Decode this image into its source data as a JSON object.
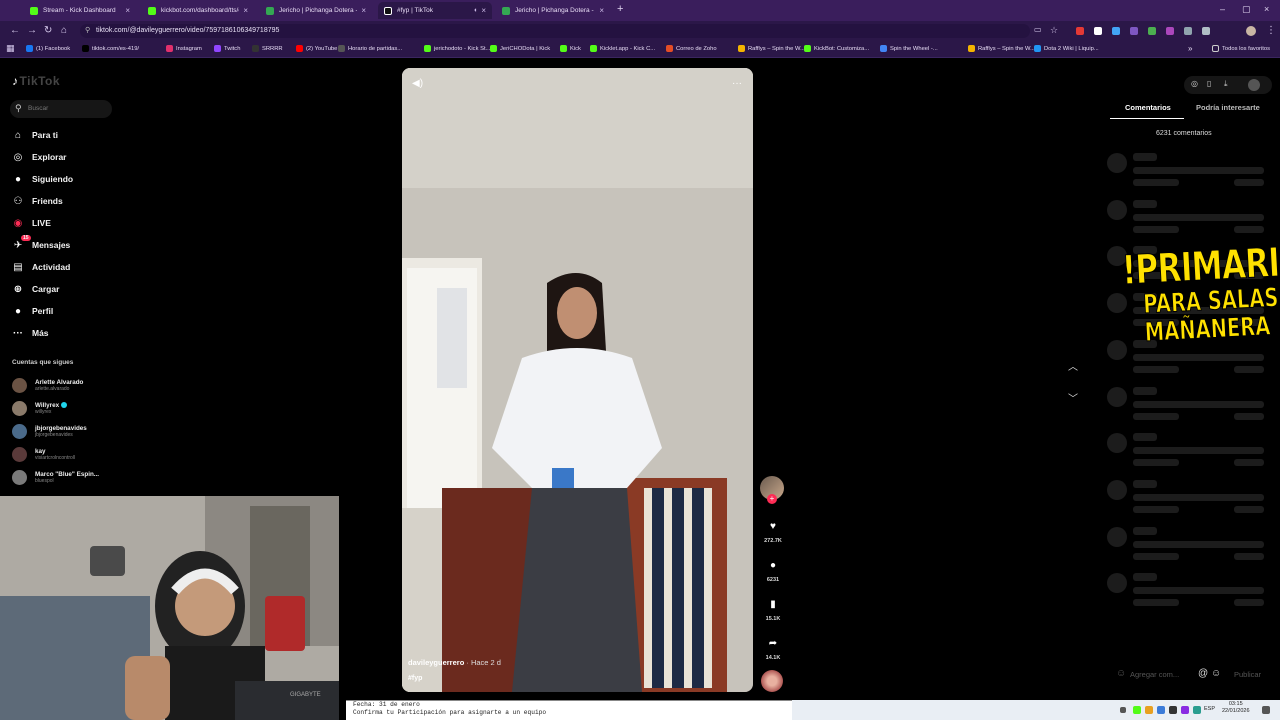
{
  "browser": {
    "tabs": [
      {
        "label": "Stream - Kick Dashboard",
        "color": "#53fc18",
        "active": false
      },
      {
        "label": "kickbot.com/dashboard/tts/co",
        "color": "#53fc18",
        "active": false
      },
      {
        "label": "Jericho | Pichanga Dotera - Ho",
        "color": "#34a853",
        "active": false
      },
      {
        "label": "#fyp | TikTok",
        "color": "#ffffff",
        "active": true
      },
      {
        "label": "Jericho | Pichanga Dotera - Ho",
        "color": "#34a853",
        "active": false
      }
    ],
    "url": "tiktok.com/@davileyguerrero/video/7597186106349718795",
    "bookmarks": [
      {
        "label": "(1) Facebook",
        "color": "#1877f2"
      },
      {
        "label": "tiktok.com/es-419/",
        "color": "#000000"
      },
      {
        "label": "Instagram",
        "color": "#e1306c"
      },
      {
        "label": "Twitch",
        "color": "#9146ff"
      },
      {
        "label": "SRRRR",
        "color": "#333333"
      },
      {
        "label": "(2) YouTube",
        "color": "#ff0000"
      },
      {
        "label": "Horario de partidas...",
        "color": "#555555"
      },
      {
        "label": "jerichodoto - Kick St...",
        "color": "#53fc18"
      },
      {
        "label": "JeriCHODota | Kick",
        "color": "#53fc18"
      },
      {
        "label": "Kick",
        "color": "#53fc18"
      },
      {
        "label": "Kicklet.app - Kick C...",
        "color": "#53fc18"
      },
      {
        "label": "Correo de Zoho",
        "color": "#e44d26"
      },
      {
        "label": "Rafflys – Spin the W...",
        "color": "#f4b400"
      },
      {
        "label": "KickBot: Customiza...",
        "color": "#53fc18"
      },
      {
        "label": "Spin the Wheel -...",
        "color": "#4285f4"
      },
      {
        "label": "Rafflys – Spin the W...",
        "color": "#f4b400"
      },
      {
        "label": "Dota 2 Wiki | Liquip...",
        "color": "#2196f3"
      }
    ],
    "bookmarks_all": "Todos los favoritos"
  },
  "sidebar": {
    "logo": "TikTok",
    "search_placeholder": "Buscar",
    "nav": [
      {
        "label": "Para ti",
        "icon": "home-icon"
      },
      {
        "label": "Explorar",
        "icon": "compass-icon"
      },
      {
        "label": "Siguiendo",
        "icon": "following-icon"
      },
      {
        "label": "Friends",
        "icon": "friends-icon"
      },
      {
        "label": "LIVE",
        "icon": "live-icon"
      },
      {
        "label": "Mensajes",
        "icon": "messages-icon",
        "badge": "15"
      },
      {
        "label": "Actividad",
        "icon": "activity-icon"
      },
      {
        "label": "Cargar",
        "icon": "upload-icon"
      },
      {
        "label": "Perfil",
        "icon": "profile-icon"
      },
      {
        "label": "Más",
        "icon": "more-icon"
      }
    ],
    "following_title": "Cuentas que sigues",
    "accounts": [
      {
        "name": "Arlette Alvarado",
        "handle": "arlette.alvarado",
        "color": "#6b5344"
      },
      {
        "name": "Willyrex",
        "handle": "willyrex",
        "color": "#8a7a6a",
        "verified": true
      },
      {
        "name": "jbjorgebenavides",
        "handle": "jbjorgebenavides",
        "color": "#4a6a8a"
      },
      {
        "name": "kay",
        "handle": "visiartcrolncontroll",
        "color": "#5a3a3a"
      },
      {
        "name": "Marco \"Blue\" Espin...",
        "handle": "bluespol",
        "color": "#7a7a7a"
      }
    ]
  },
  "video": {
    "username": "davileyguerrero",
    "time": "· Hace 2 d",
    "hashtag": "#fyp"
  },
  "actions": {
    "likes": "272.7K",
    "comments": "6231",
    "saves": "15.1K",
    "shares": "14.1K"
  },
  "comments_panel": {
    "tab_comments": "Comentarios",
    "tab_suggested": "Podría interesarte",
    "count": "6231 comentarios",
    "input_placeholder": "Agregar com...",
    "post_label": "Publicar"
  },
  "overlay": {
    "line1": "!PRIMARIA",
    "line2": "PARA SALAS",
    "line3": "MAÑANERA"
  },
  "notepad": {
    "line1": "Fecha: 31 de enero",
    "line2": "Confirma tu Participación para asignarte a un equipo"
  },
  "taskbar": {
    "lang": "ESP",
    "time": "03:15",
    "date": "22/01/2026"
  }
}
